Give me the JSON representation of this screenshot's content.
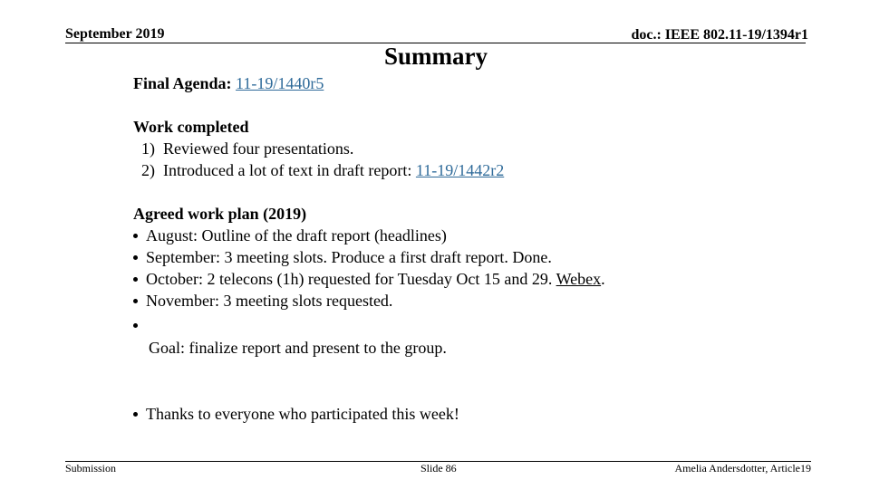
{
  "header": {
    "date": "September 2019",
    "doc_id": "doc.: IEEE 802.11-19/1394r1"
  },
  "slide": {
    "title": "Summary",
    "final_agenda": {
      "label": "Final Agenda:",
      "link_text": "11-19/1440r5"
    },
    "work_completed": {
      "heading": "Work completed",
      "items": [
        {
          "number": "1)",
          "text": "Reviewed four presentations."
        },
        {
          "number": "2)",
          "text": "Introduced a lot of text in draft report:",
          "link_text": "11-19/1442r2"
        }
      ]
    },
    "work_plan": {
      "heading": "Agreed work plan (2019)",
      "items": [
        {
          "text": "August: Outline of the draft report (headlines)"
        },
        {
          "text": "September: 3 meeting slots. Produce a first draft report. Done."
        },
        {
          "text": "October: 2 telecons (1h) requested for Tuesday Oct 15 and 29.",
          "link_text": "Webex",
          "suffix": "."
        },
        {
          "text": "November: 3 meeting slots requested."
        },
        {
          "text": ""
        }
      ],
      "goal": "Goal: finalize report and present to the group."
    },
    "thanks": "Thanks to everyone who participated this week!"
  },
  "footer": {
    "left": "Submission",
    "center": "Slide 86",
    "right": "Amelia Andersdotter, Article19"
  },
  "colors": {
    "link": "#2e6a99",
    "text": "#000000",
    "background": "#ffffff"
  }
}
